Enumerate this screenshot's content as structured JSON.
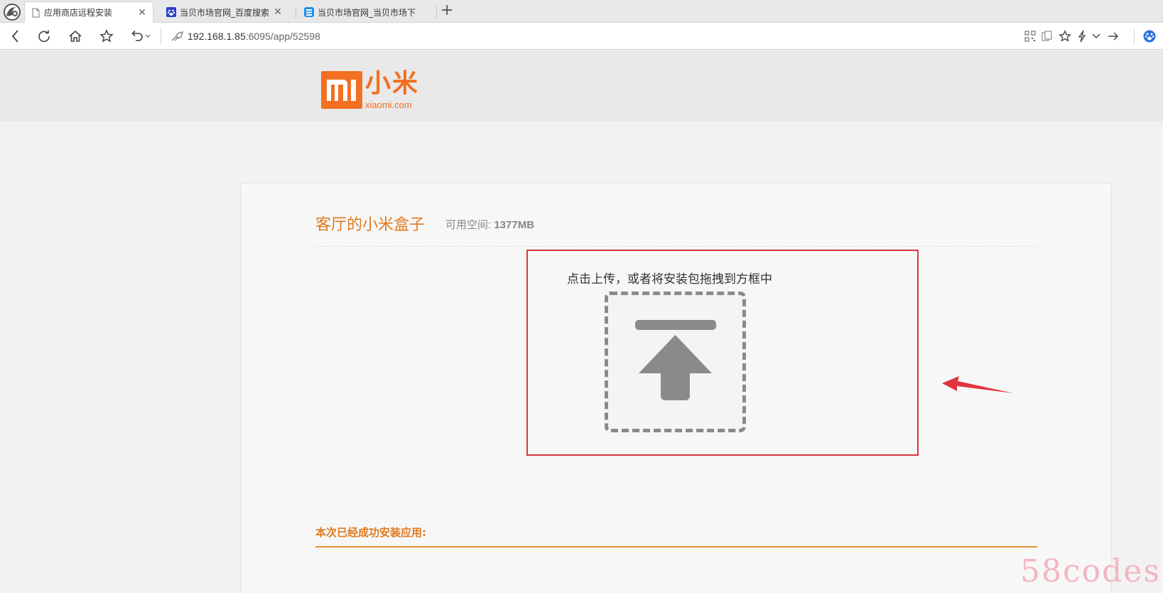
{
  "browser": {
    "tabs": [
      {
        "title": "应用商店远程安装",
        "active": true
      },
      {
        "title": "当贝市场官网_百度搜索",
        "active": false
      },
      {
        "title": "当贝市场官网_当贝市场下",
        "active": false
      }
    ],
    "new_tab_glyph": "+",
    "close_glyph": "✕",
    "url_host": "192.168.1.85",
    "url_path": ":6095/app/52598"
  },
  "header": {
    "logo_text": "小米",
    "logo_domain": "xiaomi.com"
  },
  "device": {
    "name": "客厅的小米盒子",
    "space_label": "可用空间: ",
    "space_value": "1377MB"
  },
  "upload": {
    "hint": "点击上传，或者将安装包拖拽到方框中"
  },
  "installed": {
    "label": "本次已经成功安装应用:"
  },
  "watermark": "58codes",
  "colors": {
    "accent": "#e07a1f",
    "mi_orange": "#f36f21",
    "highlight_red": "#d9363e",
    "upload_gray": "#8a8a8a"
  }
}
